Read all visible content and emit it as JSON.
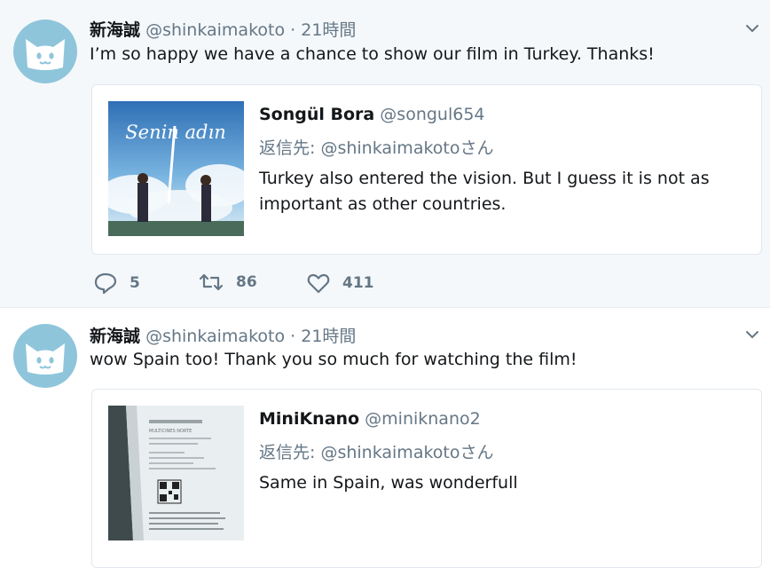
{
  "tweets": [
    {
      "author_name": "新海誠",
      "author_handle": "@shinkaimakoto",
      "separator": "·",
      "time": "21時間",
      "text": "I’m so happy we have a chance to show our film in Turkey. Thanks!",
      "quote": {
        "name": "Songül Bora",
        "handle": "@songul654",
        "reply_prefix": "返信先:",
        "reply_to": "@shinkaimakotoさん",
        "text": "Turkey also entered the vision. But I guess it is not as important as other countries.",
        "image_title": "Senin adın"
      },
      "actions": {
        "replies": "5",
        "retweets": "86",
        "likes": "411"
      }
    },
    {
      "author_name": "新海誠",
      "author_handle": "@shinkaimakoto",
      "separator": "·",
      "time": "21時間",
      "text": "wow Spain too! Thank you so much for watching the film!",
      "quote": {
        "name": "MiniKnano",
        "handle": "@miniknano2",
        "reply_prefix": "返信先:",
        "reply_to": "@shinkaimakotoさん",
        "text": "Same in Spain, was wonderfull",
        "image_title": "MULTICINES NORTE"
      }
    }
  ],
  "colors": {
    "accent": "#1da1f2",
    "muted": "#657786",
    "avatar_bg": "#8ec5db",
    "border": "#e1e8ed"
  },
  "icons": {
    "reply": "speech-bubble",
    "retweet": "retweet-arrows",
    "like": "heart",
    "caret": "chevron-down"
  }
}
